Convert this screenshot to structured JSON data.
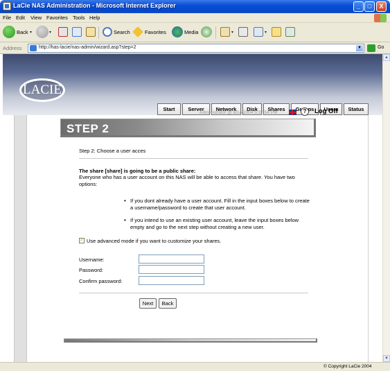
{
  "window": {
    "title": "LaCie NAS Administration - Microsoft Internet Explorer",
    "min": "_",
    "max": "□",
    "close": "X"
  },
  "menu": [
    "File",
    "Edit",
    "View",
    "Favorites",
    "Tools",
    "Help"
  ],
  "toolbar": {
    "back": "Back",
    "search": "Search",
    "favorites": "Favorites",
    "media": "Media"
  },
  "address": {
    "label": "Address",
    "url": "http://has-lacie/nas-admin/wizard.asp?step=2",
    "go": "Go"
  },
  "site": {
    "logo": "LACIE",
    "tabs": [
      "Start",
      "Server",
      "Network",
      "Disk",
      "Shares",
      "Groups",
      "Users",
      "Status"
    ],
    "user_status": "Administrator @ 6/14/2004 5:37:54 PM",
    "help": "?",
    "logoff": "Log Off"
  },
  "step": {
    "title": "STEP 2",
    "subtitle": "Step 2: Choose a user acces",
    "intro_bold": "The share [share] is going to be a public share:",
    "intro": "Everyone who has a user account on this NAS will be able to access that share. You have two options:",
    "bullets": [
      "If you dont already have a user account. Fill in the input boxes below to create a username/password to create that user account.",
      "If you intend to use an existing user account, leave the input boxes below empty and go to the next step without creating a new user."
    ],
    "advanced": "Use advanced mode if you want to customize your shares.",
    "advanced_checked": true,
    "fields": {
      "username": "Username:",
      "password": "Password:",
      "confirm": "Confirm password:"
    },
    "next": "Next",
    "back": "Back"
  },
  "status": {
    "copyright": "© Copyright LaCie 2004"
  }
}
